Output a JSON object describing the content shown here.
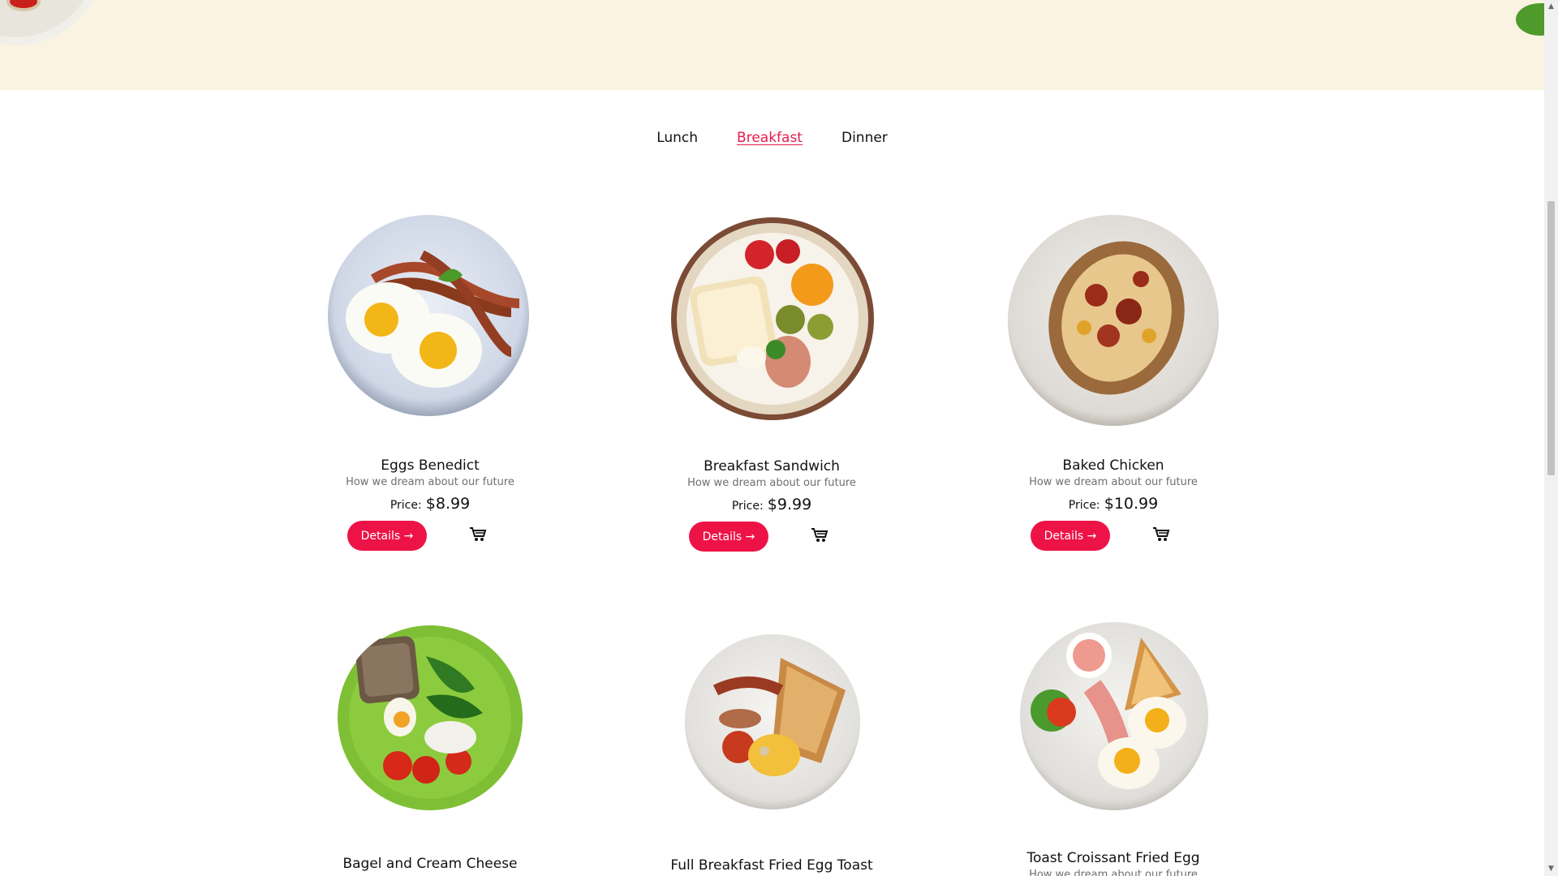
{
  "tabs": [
    {
      "label": "Lunch",
      "active": false
    },
    {
      "label": "Breakfast",
      "active": true
    },
    {
      "label": "Dinner",
      "active": false
    }
  ],
  "price_label": "Price:",
  "details_label": "Details →",
  "colors": {
    "accent": "#ee1347",
    "hero_background": "#fbf3e2"
  },
  "items": [
    {
      "title": "Eggs Benedict",
      "description": "How we dream about our future",
      "price": "$8.99"
    },
    {
      "title": "Breakfast Sandwich",
      "description": "How we dream about our future",
      "price": "$9.99"
    },
    {
      "title": "Baked Chicken",
      "description": "How we dream about our future",
      "price": "$10.99"
    },
    {
      "title": "Bagel and Cream Cheese"
    },
    {
      "title": "Full Breakfast Fried Egg Toast"
    },
    {
      "title": "Toast Croissant Fried Egg",
      "description": "How we dream about our future"
    }
  ]
}
